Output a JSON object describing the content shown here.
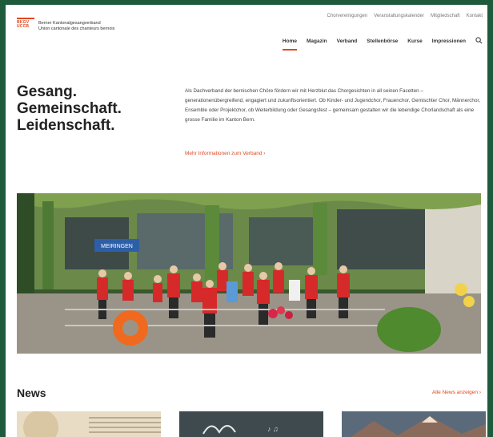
{
  "header": {
    "logo_mark": [
      "BKGV",
      "UCCB"
    ],
    "logo_lines": [
      "Berner Kantonalgesangverband",
      "Union cantonale des chanteurs bernois"
    ],
    "top_nav": [
      "Chorvereinigungen",
      "Veranstaltungskalender",
      "Mitgliedschaft",
      "Kontakt"
    ],
    "main_nav": [
      "Home",
      "Magazin",
      "Verband",
      "Stellenbörse",
      "Kurse",
      "Impressionen"
    ],
    "active_nav": "Home"
  },
  "hero": {
    "title_lines": [
      "Gesang.",
      "Gemeinschaft.",
      "Leidenschaft."
    ],
    "text": "Als Dachverband der bernischen Chöre fördern wir mit Herzblut das Chorgesichten in all seinen Facetten – generationenübergreifend, engagiert und zukunftsorientiert. Ob Kinder- und Jugendchor, Frauenchor, Gemischter Chor, Männerchor, Ensemble oder Projektchor, ob Weiterbildung oder Gesangsfest – gemeinsam gestalten wir die lebendige Chorlandschaft als eine grosse Familie im Kanton Bern.",
    "link": "Mehr Informationen zum Verband  ›"
  },
  "photo": {
    "sign_text": "MEIRINGEN"
  },
  "news": {
    "title": "News",
    "all_link": "Alle News anzeigen  ›"
  },
  "colors": {
    "accent": "#e0471f",
    "frame": "#1e5a3c"
  }
}
